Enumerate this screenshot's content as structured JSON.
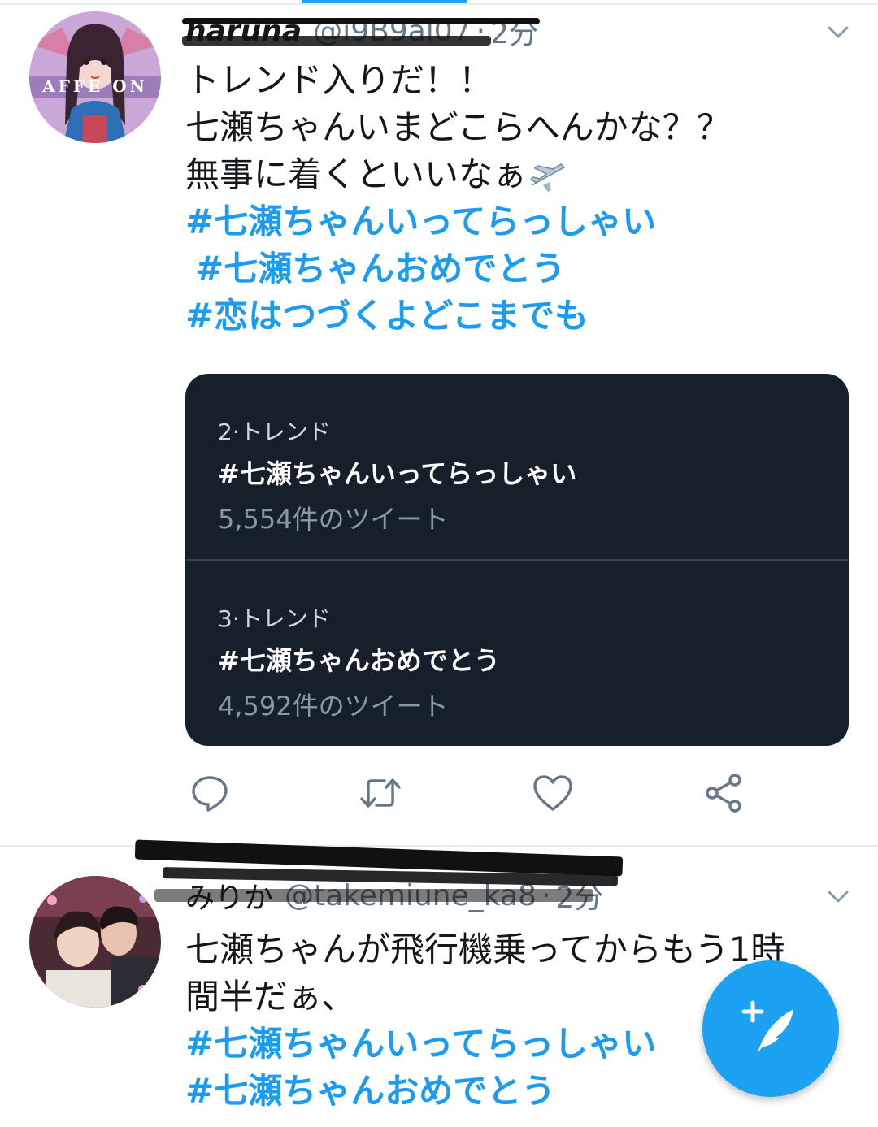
{
  "tweets": [
    {
      "name": "haruna",
      "handle": "@i9B9al07",
      "time": "2分",
      "lines": [
        "トレンド入りだ！！",
        "七瀬ちゃんいまどこらへんかな？？",
        "無事に着くといいなぁ"
      ],
      "hashtags": [
        "#七瀬ちゃんいってらっしゃい",
        "#七瀬ちゃんおめでとう",
        "#恋はつづくよどこまでも"
      ],
      "card": [
        {
          "rank": "2·トレンド",
          "tag": "#七瀬ちゃんいってらっしゃい",
          "count": "5,554件のツイート"
        },
        {
          "rank": "3·トレンド",
          "tag": "#七瀬ちゃんおめでとう",
          "count": "4,592件のツイート"
        }
      ],
      "avatar_text": "AFFE  ON"
    },
    {
      "name": "みりか",
      "handle": "@takemiune_ka8",
      "time": "2分",
      "lines": [
        "七瀬ちゃんが飛行機乗ってからもう1時",
        "間半だぁ、"
      ],
      "hashtags": [
        "#七瀬ちゃんいってらっしゃい",
        "#七瀬ちゃんおめでとう"
      ]
    }
  ],
  "icons": [
    "reply-icon",
    "retweet-icon",
    "like-icon",
    "share-icon",
    "chevron-down-icon",
    "compose-icon",
    "airplane-icon"
  ],
  "colors": {
    "accent": "#1da1f2",
    "hashtag": "#1d9bf0",
    "card_bg": "#15202b"
  }
}
